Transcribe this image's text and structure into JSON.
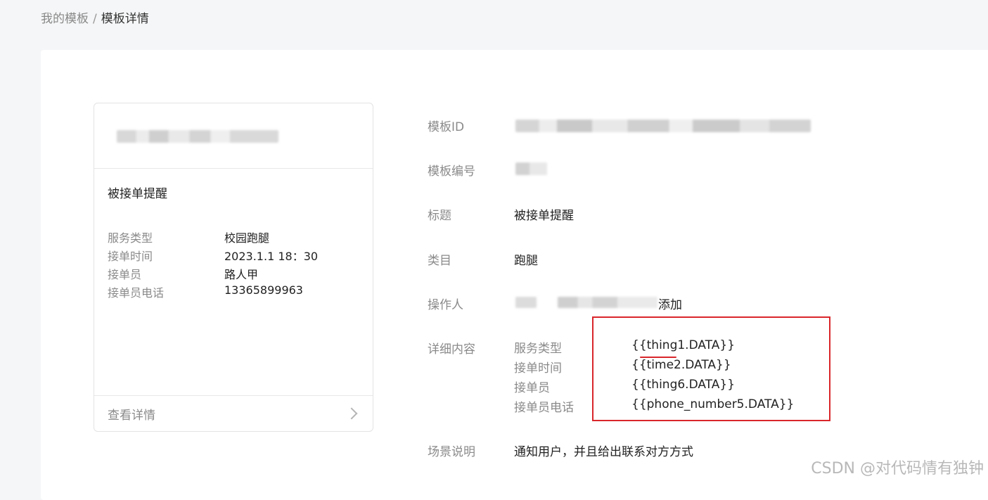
{
  "breadcrumb": {
    "parent": "我的模板",
    "separator": "/",
    "current": "模板详情"
  },
  "preview_card": {
    "title": "被接单提醒",
    "rows": [
      {
        "label": "服务类型",
        "value": "校园跑腿"
      },
      {
        "label": "接单时间",
        "value": "2023.1.1 18：30"
      },
      {
        "label": "接单员",
        "value": "路人甲"
      },
      {
        "label": "接单员电话",
        "value": "13365899963"
      }
    ],
    "footer_label": "查看详情"
  },
  "details": {
    "template_id_label": "模板ID",
    "template_number_label": "模板编号",
    "title_label": "标题",
    "title_value": "被接单提醒",
    "category_label": "类目",
    "category_value": "跑腿",
    "operator_label": "操作人",
    "operator_suffix": "添加",
    "content_label": "详细内容",
    "content_rows": [
      {
        "label": "服务类型",
        "value": "{{thing1.DATA}}"
      },
      {
        "label": "接单时间",
        "value": "{{time2.DATA}}"
      },
      {
        "label": "接单员",
        "value": "{{thing6.DATA}}"
      },
      {
        "label": "接单员电话",
        "value": "{{phone_number5.DATA}}"
      }
    ],
    "scene_label": "场景说明",
    "scene_value": "通知用户，并且给出联系对方方式"
  },
  "watermark": "CSDN @对代码情有独钟",
  "colors": {
    "annotation_red": "#d9262b",
    "page_bg": "#f5f6f7"
  }
}
